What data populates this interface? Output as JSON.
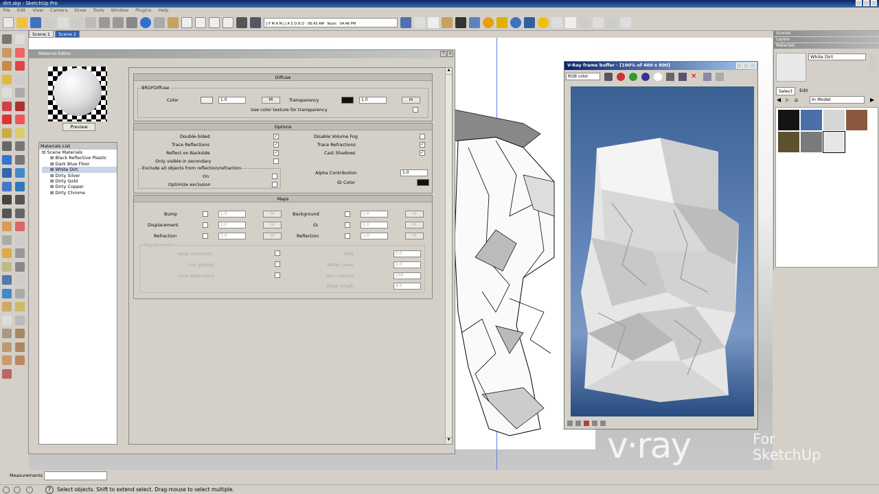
{
  "window": {
    "title": "dirt.skp - SketchUp Pro"
  },
  "menu": [
    "File",
    "Edit",
    "View",
    "Camera",
    "Draw",
    "Tools",
    "Window",
    "Plugins",
    "Help"
  ],
  "timeline": {
    "months": [
      "J",
      "F",
      "M",
      "A",
      "M",
      "J",
      "J",
      "A",
      "S",
      "O",
      "N",
      "D"
    ],
    "t1": "06:43 AM",
    "t2": "Noon",
    "t3": "04:46 PM"
  },
  "scenes": [
    "Scene 1",
    "Scene 2"
  ],
  "material_editor": {
    "title": "Material Editor",
    "preview_button": "Preview",
    "list_title": "Materials List",
    "tree_root": "Scene Materials",
    "materials": [
      "Black Reflective Plastic",
      "Dark Blue Floor",
      "White Dirt",
      "Dirty Silver",
      "Dirty Gold",
      "Dirty Copper",
      "Dirty Chrome"
    ],
    "selected_material": "White Dirt",
    "diffuse": {
      "header": "Diffuse",
      "group": "BRDFDiffuse",
      "color_label": "Color",
      "color_value": "1.0",
      "m_label": "M",
      "transparency_label": "Transparency",
      "transparency_value": "1.0",
      "m2_label": "m",
      "use_color_tex": "Use color texture for transparency"
    },
    "options": {
      "header": "Options",
      "double_sided": "Double-Sided",
      "trace_reflections": "Trace Reflections",
      "reflect_backside": "Reflect on Backside",
      "only_visible_secondary": "Only visible in secondary",
      "exclude_group": "Exclude all objects from reflection/refraction",
      "on": "On",
      "optimize_exclusion": "Optimize exclusion",
      "disable_volume_fog": "Disable Volume Fog",
      "trace_refractions": "Trace Refractions",
      "cast_shadows": "Cast Shadows",
      "alpha_contribution": "Alpha Contribution",
      "alpha_value": "1.0",
      "id_color": "ID Color"
    },
    "maps": {
      "header": "Maps",
      "bump": "Bump",
      "displacement": "Displacement",
      "refraction": "Refraction",
      "background": "Background",
      "gi": "GI",
      "reflection": "Reflection",
      "value": "1.0",
      "m": "m",
      "disp_group": "Displacement",
      "keep_continuity": "Keep continuity",
      "use_globals": "Use globals",
      "view_dependent": "View dependent",
      "shift": "Shift",
      "shift_value": "0.0",
      "water_level": "Water Level",
      "water_value": "0.0",
      "max_subdivs": "Max subdivs",
      "max_subdivs_value": "256",
      "edge_length": "Edge length",
      "edge_length_value": "4.0"
    }
  },
  "vfb": {
    "title": "V-Ray frame buffer - [100% of 400 x 800]",
    "channel": "RGB color"
  },
  "right_panel": {
    "scenes": "Scenes",
    "layers": "Layers",
    "materials": "Materials",
    "material_name": "White Dirt",
    "tab_select": "Select",
    "tab_edit": "Edit",
    "dropdown": "In Model",
    "swatches": [
      "#141414",
      "#4b6fa8",
      "#d6d6d6",
      "#8b5a3e",
      "#5e5130",
      "#7a7a7a",
      "#e6e6e6"
    ]
  },
  "measurements_label": "Measurements",
  "status": "Select objects. Shift to extend select. Drag mouse to select multiple.",
  "logo": {
    "brand": "v·ray",
    "for": "For",
    "product": "SketchUp"
  }
}
